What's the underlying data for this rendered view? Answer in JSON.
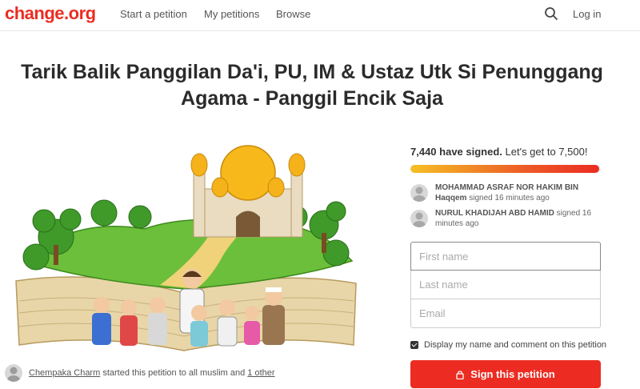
{
  "header": {
    "logo": "change.org",
    "nav": [
      "Start a petition",
      "My petitions",
      "Browse"
    ],
    "search_icon": "search-icon",
    "login": "Log in",
    "brand_color": "#ec2c22"
  },
  "petition": {
    "title_line1": "Tarik Balik Panggilan Da'i, PU, IM & Ustaz Utk Si Penunggang",
    "title_line2": "Agama - Panggil Encik Saja"
  },
  "starter": {
    "name": "Chempaka Charm",
    "text": " started this petition to all muslim and ",
    "others": "1 other"
  },
  "signatures": {
    "count_text": "7,440 have signed.",
    "goal_text": " Let's get to 7,500!",
    "progress_fraction": 0.992
  },
  "recent_signers": [
    {
      "name": "MOHAMMAD ASRAF NOR HAKIM BIN Haqqem",
      "time": " signed 16 minutes ago"
    },
    {
      "name": "NURUL KHADIJAH ABD HAMID",
      "time": " signed 16 minutes ago"
    }
  ],
  "form": {
    "first_name_placeholder": "First name",
    "last_name_placeholder": "Last name",
    "email_placeholder": "Email",
    "display_label": "Display my name and comment on this petition",
    "display_checked": true,
    "sign_button": "Sign this petition",
    "sign_icon": "lock-icon"
  }
}
